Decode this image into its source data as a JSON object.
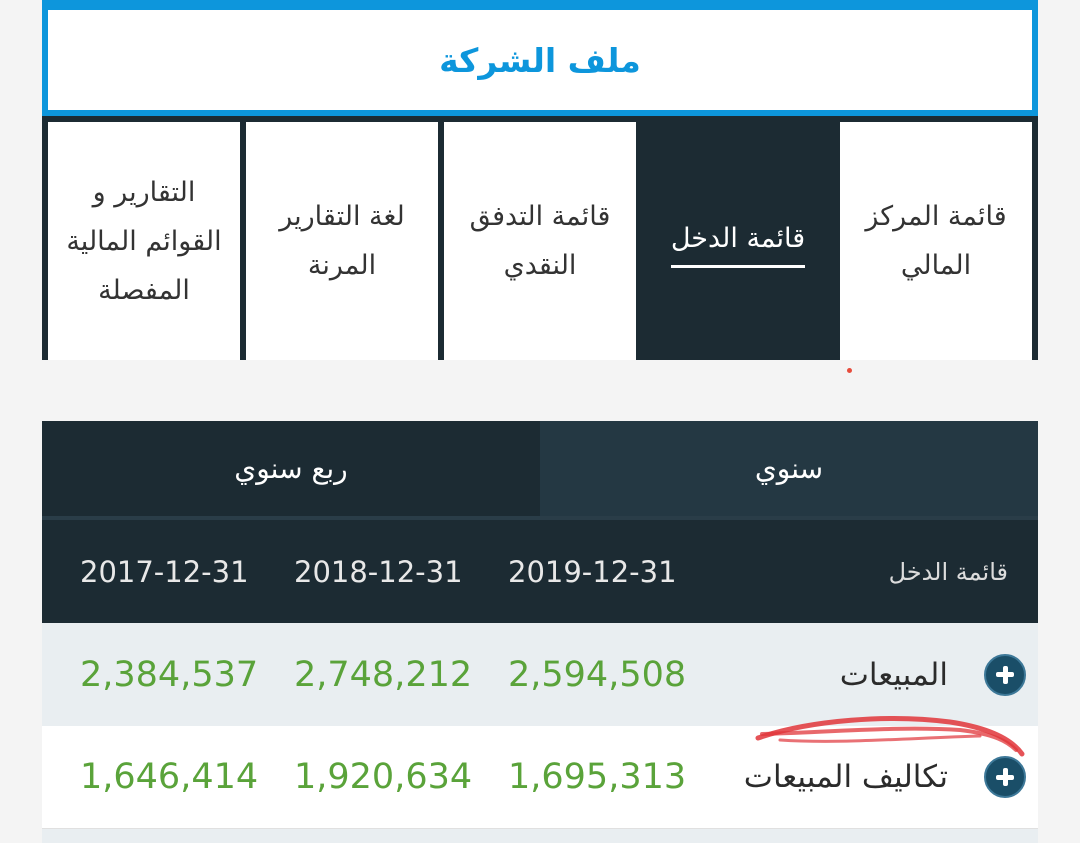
{
  "header": {
    "title": "ملف الشركة"
  },
  "tabs": [
    {
      "label": "قائمة المركز المالي",
      "active": false
    },
    {
      "label": "قائمة الدخل",
      "active": true
    },
    {
      "label": "قائمة التدفق النقدي",
      "active": false
    },
    {
      "label": "لغة التقارير المرنة",
      "active": false
    },
    {
      "label": "التقارير و القوائم المالية المفصلة",
      "active": false
    }
  ],
  "periods": [
    {
      "label": "سنوي",
      "active": true
    },
    {
      "label": "ربع سنوي",
      "active": false
    }
  ],
  "table": {
    "title": "قائمة الدخل",
    "columns": [
      "2019-12-31",
      "2018-12-31",
      "2017-12-31"
    ],
    "rows": [
      {
        "name": "المبيعات",
        "values": [
          "2,594,508",
          "2,748,212",
          "2,384,537"
        ]
      },
      {
        "name": "تكاليف المبيعات",
        "values": [
          "1,695,313",
          "1,920,634",
          "1,646,414"
        ]
      }
    ]
  },
  "colors": {
    "brand_blue": "#0d96dc",
    "dark_header": "#1c2b33",
    "value_green": "#5aa33a",
    "row_alt": "#e9eef1",
    "annotation_red": "#e0353a"
  },
  "icons": {
    "row_expand": "plus-circle-icon"
  }
}
